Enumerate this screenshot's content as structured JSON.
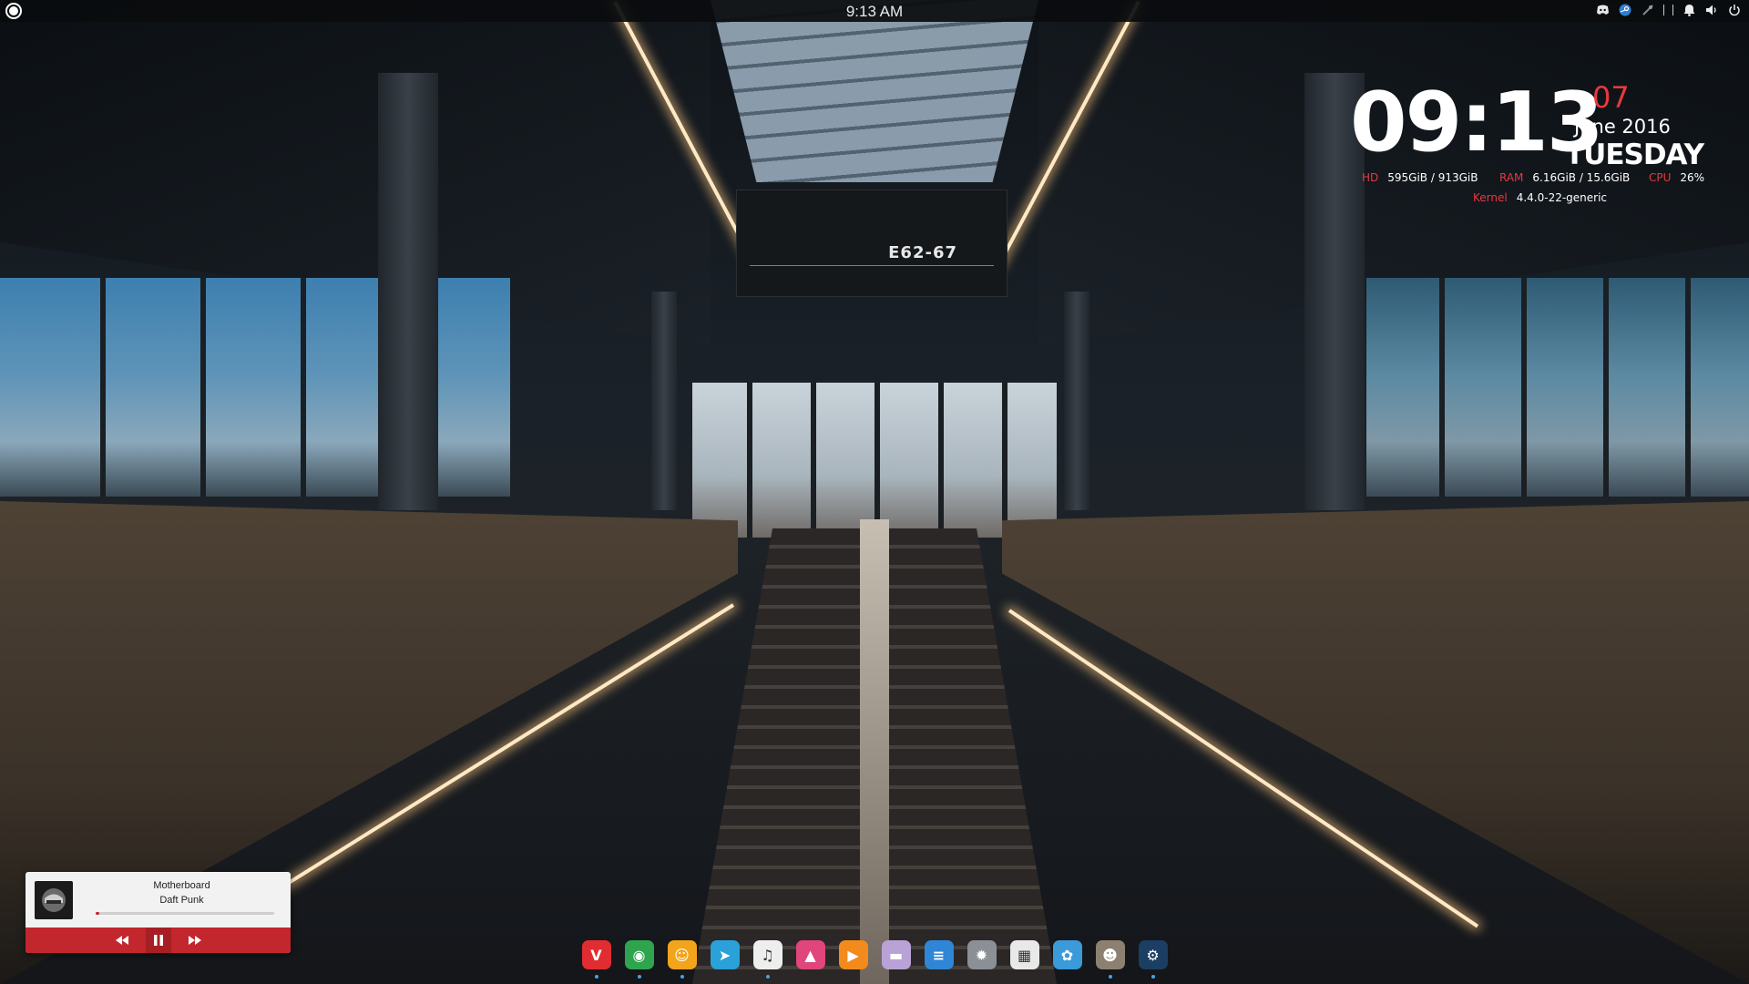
{
  "top_panel": {
    "clock": "9:13 AM",
    "tray_icons": [
      "discord-tray-icon",
      "steam-tray-icon",
      "network-tray-icon",
      "notifications-icon",
      "volume-icon",
      "power-icon"
    ]
  },
  "conky": {
    "time": "09:13",
    "day_number": "07",
    "month_year": "June 2016",
    "weekday": "TUESDAY",
    "hd_label": "HD",
    "hd_value": "595GiB / 913GiB",
    "ram_label": "RAM",
    "ram_value": "6.16GiB / 15.6GiB",
    "cpu_label": "CPU",
    "cpu_value": "26%",
    "kernel_label": "Kernel",
    "kernel_value": "4.4.0-22-generic",
    "accent": "#e8383d"
  },
  "wallpaper": {
    "sign_text": "E62-67"
  },
  "music_player": {
    "title": "Motherboard",
    "artist": "Daft Punk",
    "progress": 0.02,
    "accent": "#c1272d",
    "controls": [
      "rewind-icon",
      "pause-icon",
      "fast-forward-icon"
    ]
  },
  "dock": {
    "apps": [
      {
        "name": "vivaldi",
        "glyph": "V",
        "color": "#e12d31",
        "running": true
      },
      {
        "name": "chrome",
        "glyph": "◉",
        "color": "#2ea44f",
        "running": true
      },
      {
        "name": "discord",
        "glyph": "☺",
        "color": "#f2a51a",
        "running": true
      },
      {
        "name": "telegram",
        "glyph": "➤",
        "color": "#2aa1d8",
        "running": false
      },
      {
        "name": "music",
        "glyph": "♫",
        "color": "#eeeeee",
        "running": true
      },
      {
        "name": "photos",
        "glyph": "▲",
        "color": "#e0457b",
        "running": false
      },
      {
        "name": "video-player",
        "glyph": "▶",
        "color": "#f28a1c",
        "running": false
      },
      {
        "name": "files",
        "glyph": "▬",
        "color": "#b9a3d6",
        "running": false
      },
      {
        "name": "documents",
        "glyph": "≡",
        "color": "#2f86d6",
        "running": false
      },
      {
        "name": "settings",
        "glyph": "✹",
        "color": "#8b8f96",
        "running": false
      },
      {
        "name": "calendar",
        "glyph": "▦",
        "color": "#e9e9e9",
        "running": false
      },
      {
        "name": "app-launcher",
        "glyph": "✿",
        "color": "#3b9ad9",
        "running": false
      },
      {
        "name": "gimp",
        "glyph": "☻",
        "color": "#8c8170",
        "running": true
      },
      {
        "name": "steam",
        "glyph": "⚙",
        "color": "#1b3e62",
        "running": true
      }
    ]
  }
}
